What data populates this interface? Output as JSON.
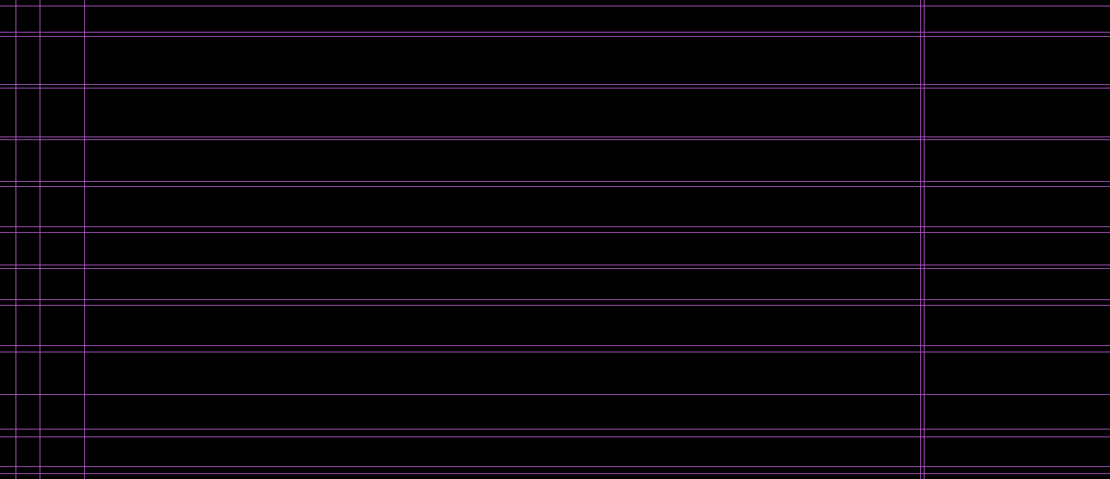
{
  "canvas": {
    "background_color": "#000000"
  },
  "guides": {
    "color": "#c060d8",
    "horizontal_count": 23,
    "vertical_count": 5
  }
}
